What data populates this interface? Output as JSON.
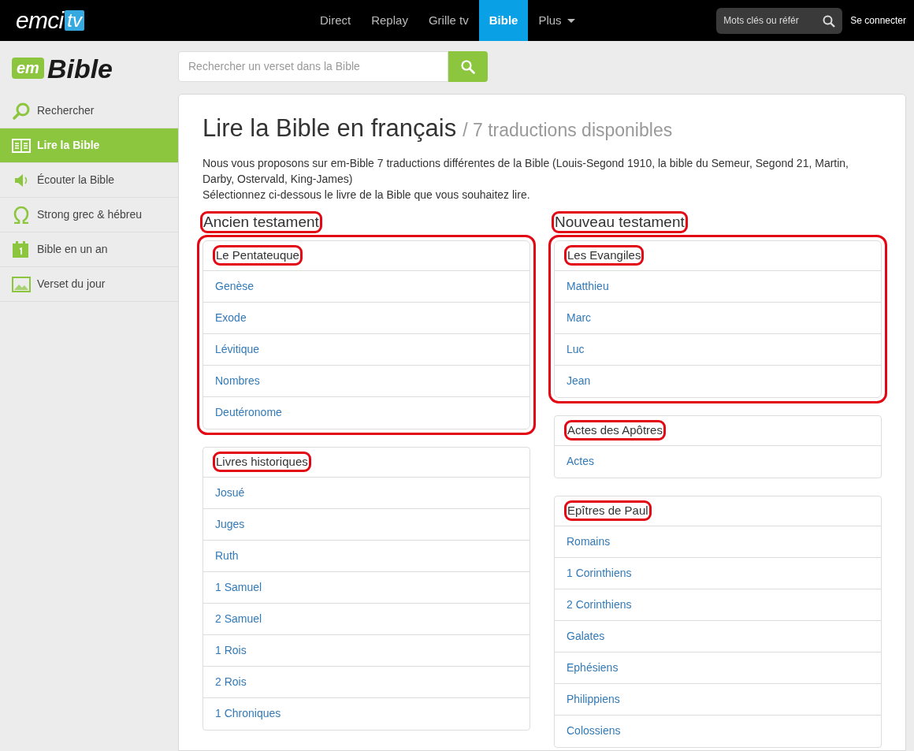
{
  "topbar": {
    "logo": {
      "text": "emci",
      "badge": "tv"
    },
    "nav": [
      {
        "label": "Direct",
        "selected": false
      },
      {
        "label": "Replay",
        "selected": false
      },
      {
        "label": "Grille tv",
        "selected": false
      },
      {
        "label": "Bible",
        "selected": true
      },
      {
        "label": "Plus",
        "selected": false,
        "dropdown": true
      }
    ],
    "search": {
      "placeholder": "Mots clés ou référ"
    },
    "login": "Se connecter"
  },
  "logo": {
    "badge": "em",
    "text": "Bible"
  },
  "search": {
    "placeholder": "Rechercher un verset dans la Bible"
  },
  "sidebar": {
    "items": [
      {
        "label": "Rechercher",
        "kind": "search",
        "selected": false
      },
      {
        "label": "Lire la Bible",
        "kind": "book",
        "selected": true
      },
      {
        "label": "Écouter la Bible",
        "kind": "speaker",
        "selected": false
      },
      {
        "label": "Strong grec & hébreu",
        "kind": "omega",
        "selected": false
      },
      {
        "label": "Bible en un an",
        "kind": "calendar",
        "selected": false
      },
      {
        "label": "Verset du jour",
        "kind": "image",
        "selected": false
      }
    ]
  },
  "page": {
    "title": "Lire la Bible en français",
    "subtitle": "/ 7 traductions disponibles",
    "intro": "Nous vous proposons sur em-Bible 7 traductions différentes de la Bible (Louis-Segond 1910, la bible du Semeur, Segond 21, Martin, Darby, Ostervald, King-James)",
    "hint": "Sélectionnez ci-dessous le livre de la Bible que vous souhaitez lire."
  },
  "columns": [
    {
      "heading": "Ancien testament",
      "highlighted": true,
      "groups": [
        {
          "title": "Le Pentateuque",
          "highlighted": true,
          "panel_highlighted": true,
          "books": [
            "Genèse",
            "Exode",
            "Lévitique",
            "Nombres",
            "Deutéronome"
          ]
        },
        {
          "title": "Livres historiques",
          "highlighted": true,
          "panel_highlighted": false,
          "books": [
            "Josué",
            "Juges",
            "Ruth",
            "1 Samuel",
            "2 Samuel",
            "1 Rois",
            "2 Rois",
            "1 Chroniques"
          ]
        }
      ]
    },
    {
      "heading": "Nouveau testament",
      "highlighted": true,
      "groups": [
        {
          "title": "Les Evangiles",
          "highlighted": true,
          "panel_highlighted": true,
          "books": [
            "Matthieu",
            "Marc",
            "Luc",
            "Jean"
          ]
        },
        {
          "title": "Actes des Apôtres",
          "highlighted": true,
          "panel_highlighted": false,
          "books": [
            "Actes"
          ]
        },
        {
          "title": "Epîtres de Paul",
          "highlighted": true,
          "panel_highlighted": false,
          "books": [
            "Romains",
            "1 Corinthiens",
            "2 Corinthiens",
            "Galates",
            "Ephésiens",
            "Philippiens",
            "Colossiens"
          ]
        }
      ]
    }
  ]
}
